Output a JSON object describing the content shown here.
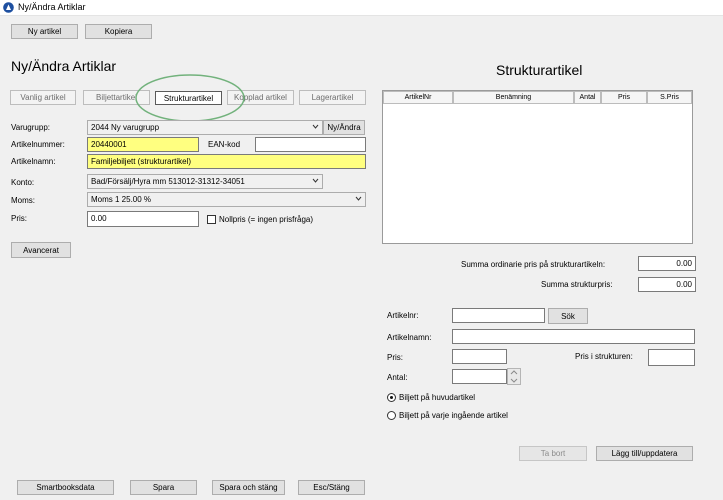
{
  "window": {
    "title": "Ny/Ändra Artiklar"
  },
  "toolbar": {
    "new_article": "Ny artikel",
    "copy": "Kopiera"
  },
  "page": {
    "heading": "Ny/Ändra Artiklar"
  },
  "tabs": [
    {
      "label": "Vanlig artikel",
      "active": false
    },
    {
      "label": "Biljettartikel",
      "active": false
    },
    {
      "label": "Strukturartikel",
      "active": true
    },
    {
      "label": "Kopplad artikel",
      "active": false
    },
    {
      "label": "Lagerartikel",
      "active": false
    }
  ],
  "form": {
    "varugrupp_label": "Varugrupp:",
    "varugrupp_value": "2044 Ny varugrupp",
    "new_edit_label": "Ny/Ändra",
    "artikelnummer_label": "Artikelnummer:",
    "artikelnummer_value": "20440001",
    "ean_label": "EAN-kod",
    "ean_value": "",
    "artikelnamn_label": "Artikelnamn:",
    "artikelnamn_value": "Familjebiljett (strukturartikel)",
    "konto_label": "Konto:",
    "konto_value": "Bad/Försälj/Hyra mm 513012-31312-34051",
    "moms_label": "Moms:",
    "moms_value": "Moms 1 25.00 %",
    "pris_label": "Pris:",
    "pris_value": "0.00",
    "nollpris_label": "Nollpris (= ingen prisfråga)",
    "nollpris_checked": false,
    "advanced_label": "Avancerat"
  },
  "structure": {
    "heading": "Strukturartikel",
    "columns": [
      "ArtikelNr",
      "Benämning",
      "Antal",
      "Pris",
      "S.Pris"
    ],
    "rows": [],
    "sum_ordinary_label": "Summa ordinarie pris på strukturartikeln:",
    "sum_ordinary_value": "0.00",
    "sum_structure_label": "Summa strukturpris:",
    "sum_structure_value": "0.00"
  },
  "add_item": {
    "artikelnr_label": "Artikelnr:",
    "artikelnr_value": "",
    "search_label": "Sök",
    "artikelnamn_label": "Artikelnamn:",
    "artikelnamn_value": "",
    "pris_label": "Pris:",
    "pris_value": "",
    "pris_i_strukturen_label": "Pris i strukturen:",
    "pris_i_strukturen_value": "",
    "antal_label": "Antal:",
    "antal_value": "",
    "radio_main_label": "Biljett på huvudartikel",
    "radio_main_checked": true,
    "radio_each_label": "Biljett på varje ingående artikel",
    "radio_each_checked": false,
    "remove_label": "Ta bort",
    "add_update_label": "Lägg till/uppdatera"
  },
  "footer": {
    "smartbooks_label": "Smartbooksdata",
    "save_label": "Spara",
    "save_close_label": "Spara och stäng",
    "esc_close_label": "Esc/Stäng"
  }
}
